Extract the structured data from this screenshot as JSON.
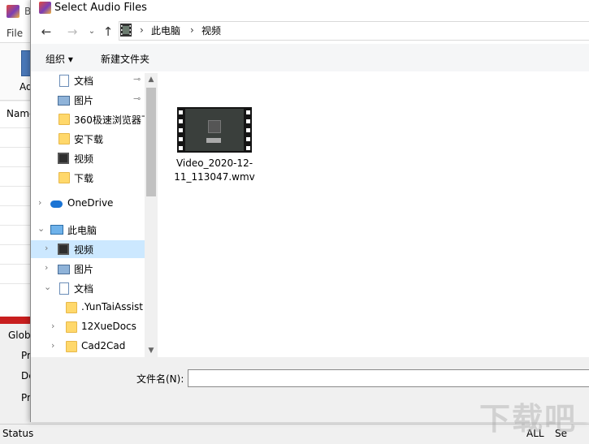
{
  "background_app": {
    "title_char": "B",
    "menu_file": "File",
    "toolbar_add": "Ad",
    "list_header": "Name",
    "global_label": "Globa",
    "panel_labels": [
      "Pr",
      "De",
      "Pr"
    ],
    "status_label": "Status",
    "status_all": "ALL",
    "status_se": "Se",
    "accent_red": "#c81e1e"
  },
  "dialog": {
    "title": "Select Audio Files",
    "nav": {
      "back_icon": "arrow-left-icon",
      "forward_icon": "arrow-right-icon",
      "recent_icon": "chevron-down-icon",
      "up_icon": "arrow-up-icon",
      "back_glyph": "←",
      "forward_glyph": "→",
      "recent_glyph": "⌄",
      "up_glyph": "↑"
    },
    "address": {
      "crumbs": [
        "此电脑",
        "视频"
      ],
      "separator": "›"
    },
    "commands": {
      "organize": "组织 ▾",
      "new_folder": "新建文件夹"
    },
    "tree": [
      {
        "label": "文档",
        "icon": "document-icon",
        "pinned": true
      },
      {
        "label": "图片",
        "icon": "picture-icon",
        "pinned": true
      },
      {
        "label": "360极速浏览器下",
        "icon": "folder-icon"
      },
      {
        "label": "安下载",
        "icon": "folder-icon"
      },
      {
        "label": "视频",
        "icon": "video-icon"
      },
      {
        "label": "下载",
        "icon": "folder-icon"
      },
      {
        "label": "OneDrive",
        "icon": "cloud-icon",
        "chevron": ">"
      },
      {
        "label": "此电脑",
        "icon": "computer-icon",
        "chevron": "v"
      },
      {
        "label": "视频",
        "icon": "video-icon",
        "chevron": ">",
        "selected": true
      },
      {
        "label": "图片",
        "icon": "picture-icon",
        "chevron": ">"
      },
      {
        "label": "文档",
        "icon": "document-icon",
        "chevron": "v"
      },
      {
        "label": ".YunTaiAssist",
        "icon": "folder-icon"
      },
      {
        "label": "12XueDocs",
        "icon": "folder-icon",
        "chevron": ">"
      },
      {
        "label": "Cad2Cad",
        "icon": "folder-icon",
        "chevron": ">"
      }
    ],
    "pin_glyph": "📌",
    "files": [
      {
        "name": "Video_2020-12-11_113047.wmv",
        "icon": "video-file-icon"
      }
    ],
    "filename_label": "文件名(N):",
    "filename_value": ""
  },
  "watermark": "下载吧"
}
